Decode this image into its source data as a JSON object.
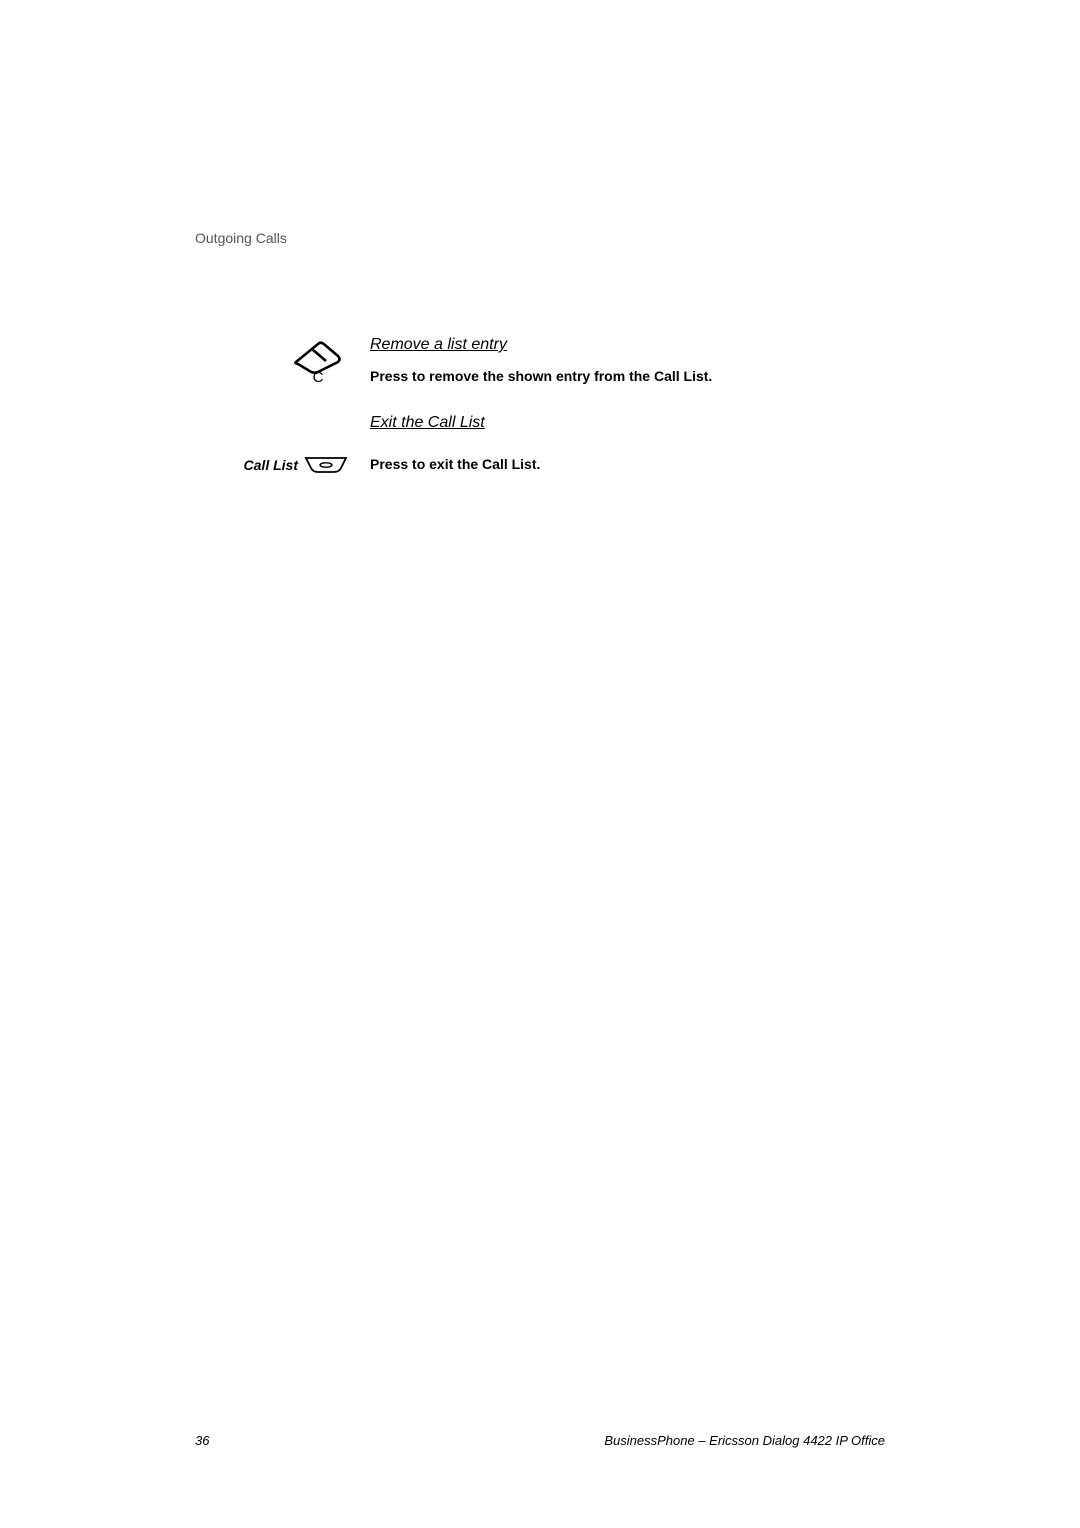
{
  "header": {
    "section": "Outgoing Calls"
  },
  "entries": {
    "remove": {
      "heading": "Remove a list entry",
      "icon_letter": "C",
      "instruction": "Press to remove the shown entry from the Call List."
    },
    "exit": {
      "heading": "Exit the Call List",
      "key_label": "Call List",
      "instruction": "Press to exit the Call List."
    }
  },
  "footer": {
    "page_number": "36",
    "product": "BusinessPhone – Ericsson Dialog 4422 IP Office"
  }
}
